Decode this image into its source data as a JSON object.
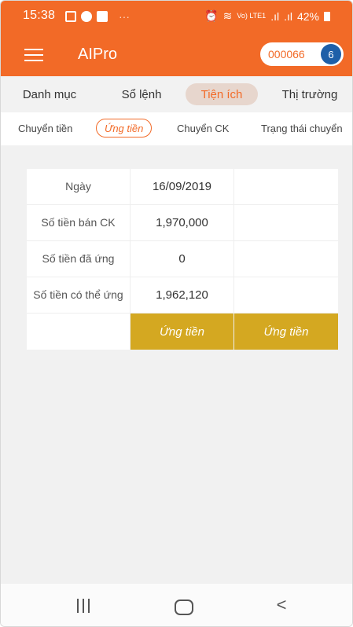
{
  "status_bar": {
    "time": "15:38",
    "dots": "···",
    "network_label": "Vo) LTE1",
    "battery_percent": "42%"
  },
  "app_bar": {
    "title": "AIPro",
    "account_number": "000066",
    "account_badge": "6"
  },
  "main_tabs": [
    {
      "label": "Danh mục",
      "active": false
    },
    {
      "label": "Sổ lệnh",
      "active": false
    },
    {
      "label": "Tiện ích",
      "active": true
    },
    {
      "label": "Thị trường",
      "active": false
    }
  ],
  "sub_tabs": [
    {
      "label": "Chuyển tiền",
      "active": false
    },
    {
      "label": "Ứng tiền",
      "active": true
    },
    {
      "label": "Chuyển CK",
      "active": false
    },
    {
      "label": "Trạng thái chuyển",
      "active": false
    }
  ],
  "advance_table": {
    "rows": [
      {
        "label": "Ngày",
        "value": "16/09/2019"
      },
      {
        "label": "Số tiền bán CK",
        "value": "1,970,000"
      },
      {
        "label": "Số tiền đã ứng",
        "value": "0"
      },
      {
        "label": "Số tiền có thể ứng",
        "value": "1,962,120"
      }
    ],
    "buttons": [
      "Ứng tiền",
      "Ứng tiền"
    ]
  },
  "colors": {
    "brand_orange": "#f26a27",
    "button_gold": "#d4a821",
    "badge_blue": "#1e5fa8"
  },
  "nav_bar": {
    "back_glyph": "<"
  }
}
